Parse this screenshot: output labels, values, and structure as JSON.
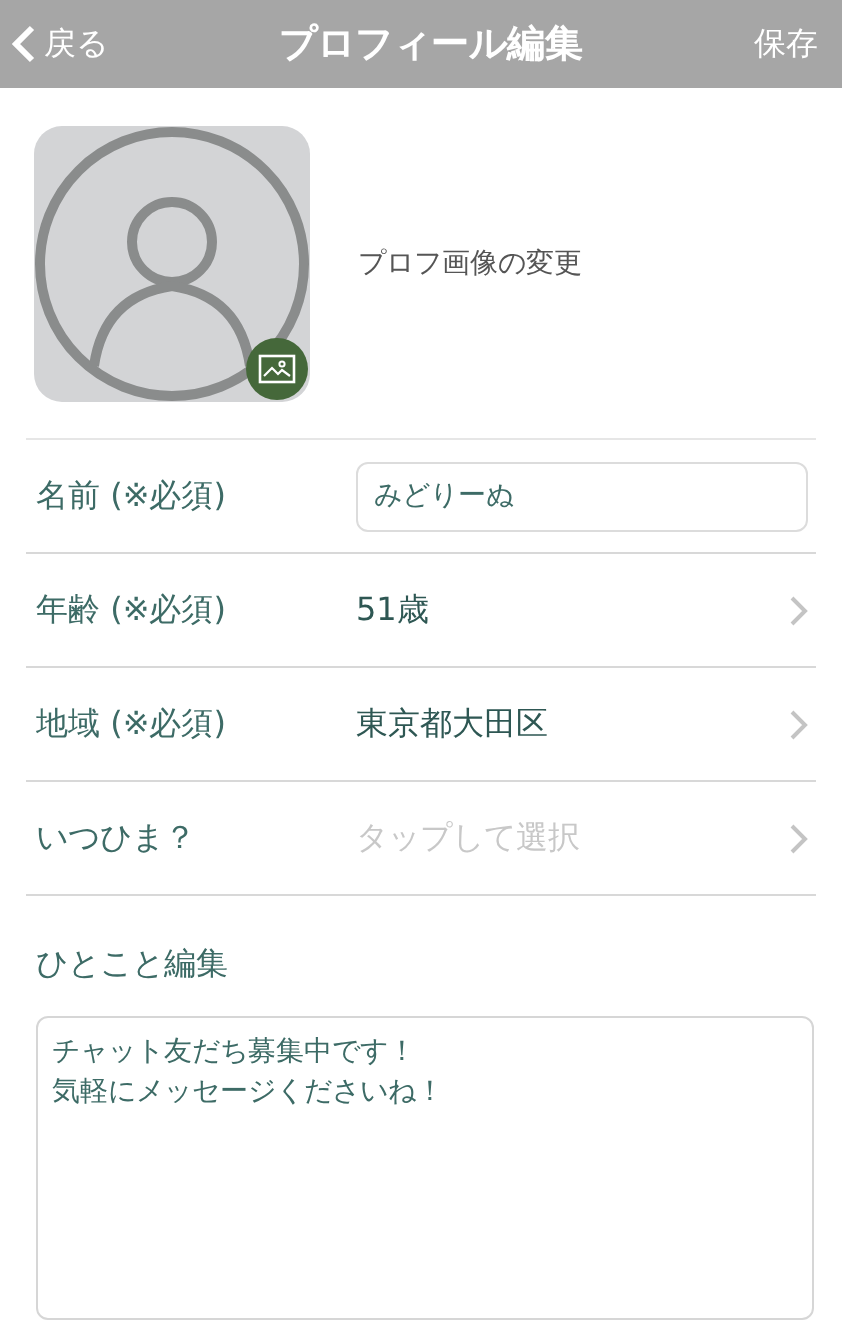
{
  "header": {
    "back": "戻る",
    "title": "プロフィール編集",
    "save": "保存"
  },
  "photo": {
    "label": "プロフ画像の変更"
  },
  "rows": [
    {
      "kind": "input",
      "label": "名前 (※必須)",
      "value": "みどりーぬ"
    },
    {
      "kind": "select",
      "label": "年齢 (※必須)",
      "value": "51歳"
    },
    {
      "kind": "select",
      "label": "地域 (※必須)",
      "value": "東京都大田区"
    },
    {
      "kind": "select",
      "label": "いつひま？",
      "placeholder": "タップして選択"
    }
  ],
  "comment": {
    "label": "ひとこと編集",
    "lines": [
      "チャット友だち募集中です！",
      "気軽にメッセージくださいね！"
    ]
  }
}
